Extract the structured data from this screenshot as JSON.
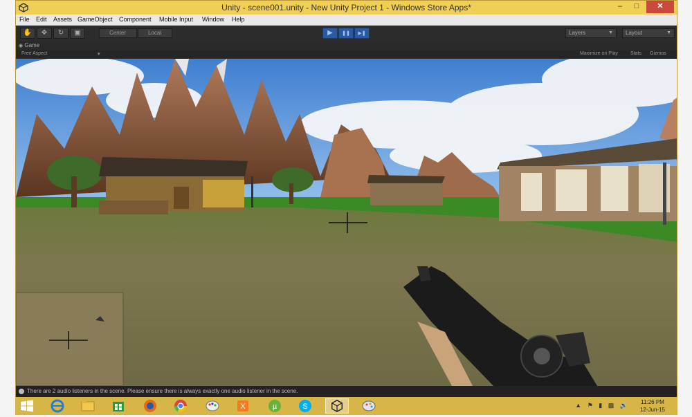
{
  "window": {
    "title": "Unity - scene001.unity - New Unity Project 1 - Windows Store Apps*",
    "min": "–",
    "max": "□",
    "close": "✕"
  },
  "menu": {
    "items": [
      "File",
      "Edit",
      "Assets",
      "GameObject",
      "Component",
      "Mobile Input",
      "Window",
      "Help"
    ]
  },
  "toolbar": {
    "tools": [
      "hand-tool",
      "move-tool",
      "rotate-tool",
      "scale-tool"
    ],
    "pivot": "Center",
    "space": "Local",
    "play": "▶",
    "pause": "❚❚",
    "step": "▶❚",
    "layers": "Layers",
    "layout": "Layout"
  },
  "game_view": {
    "tab": "Game",
    "aspect": "Free Aspect",
    "maximize": "Maximize on Play",
    "stats": "Stats",
    "gizmos": "Gizmos"
  },
  "status": {
    "message": "There are 2 audio listeners in the scene. Please ensure there is always exactly one audio listener in the scene."
  },
  "taskbar": {
    "apps": [
      "internet-explorer",
      "file-explorer",
      "store",
      "firefox",
      "chrome",
      "paint",
      "xampp",
      "utorrent",
      "skype",
      "unity",
      "paint-app"
    ],
    "active": "unity",
    "time": "11:26 PM",
    "date": "12-Jun-15"
  },
  "colors": {
    "titlebar": "#f0cf55",
    "taskbar": "#d8b547",
    "editor_dark": "#2c2c2c",
    "play_blue": "#2a5aa0"
  }
}
